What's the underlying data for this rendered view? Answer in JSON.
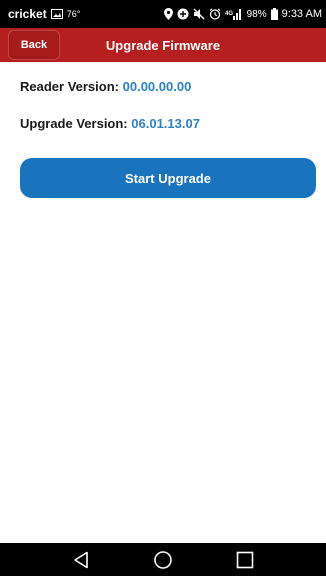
{
  "status_bar": {
    "carrier": "cricket",
    "temperature": "76°",
    "battery": "98%",
    "time": "9:33 AM",
    "icons": [
      "image-icon",
      "location-icon",
      "data-saver-icon",
      "mute-icon",
      "alarm-icon",
      "signal-icon",
      "battery-icon"
    ]
  },
  "app_bar": {
    "back_label": "Back",
    "title": "Upgrade Firmware",
    "color": "#b51f1f"
  },
  "main": {
    "reader_label": "Reader Version:",
    "reader_value": "00.00.00.00",
    "upgrade_label": "Upgrade Version:",
    "upgrade_value": "06.01.13.07",
    "start_button_label": "Start Upgrade",
    "value_color": "#2b83c5",
    "button_color": "#1a74bd"
  },
  "nav_bar": {
    "icons": [
      "back-triangle-icon",
      "home-circle-icon",
      "recents-square-icon"
    ]
  }
}
